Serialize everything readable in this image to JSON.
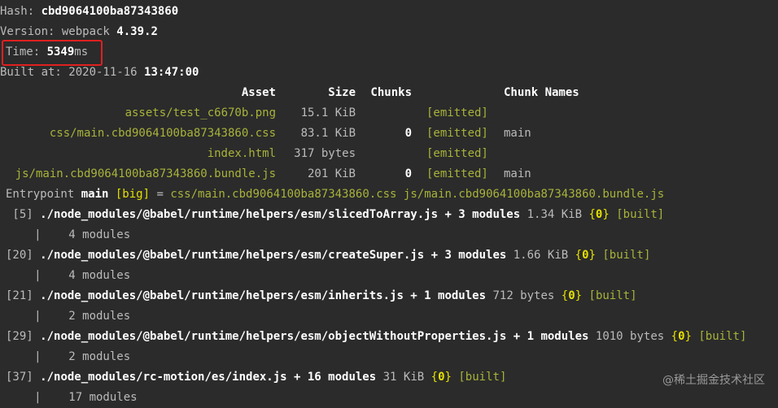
{
  "build": {
    "hash_label": "Hash: ",
    "hash_value": "cbd9064100ba87343860",
    "version_label": "Version: webpack ",
    "version_value": "4.39.2",
    "time_label": "Time: ",
    "time_value": "5349",
    "time_unit": "ms",
    "built_label": "Built at: 2020-11-16 ",
    "built_time": "13:47:00"
  },
  "table": {
    "headers": [
      "Asset",
      "Size",
      "Chunks",
      "Chunk Names"
    ],
    "rows": [
      {
        "asset": "assets/test_c6670b.png",
        "size": "15.1 KiB",
        "chunks": "",
        "emitted": "[emitted]",
        "names": ""
      },
      {
        "asset": "css/main.cbd9064100ba87343860.css",
        "size": "83.1 KiB",
        "chunks": "0",
        "emitted": "[emitted]",
        "names": "main"
      },
      {
        "asset": "index.html",
        "size": "317 bytes",
        "chunks": "",
        "emitted": "[emitted]",
        "names": ""
      },
      {
        "asset": "js/main.cbd9064100ba87343860.bundle.js",
        "size": "201 KiB",
        "chunks": "0",
        "emitted": "[emitted]",
        "names": "main"
      }
    ]
  },
  "entrypoint": {
    "label": "Entrypoint ",
    "name": "main",
    "big": "[big]",
    "eq": " = ",
    "css": "css/main.cbd9064100ba87343860.css",
    "js": "js/main.cbd9064100ba87343860.bundle.js"
  },
  "modules": [
    {
      "id": " [5]",
      "path": "./node_modules/@babel/runtime/helpers/esm/slicedToArray.js + 3 modules",
      "size": "1.34 KiB",
      "chunk": "0",
      "status": "[built]",
      "sub": "     |    4 modules"
    },
    {
      "id": "[20]",
      "path": "./node_modules/@babel/runtime/helpers/esm/createSuper.js + 3 modules",
      "size": "1.66 KiB",
      "chunk": "0",
      "status": "[built]",
      "sub": "     |    4 modules"
    },
    {
      "id": "[21]",
      "path": "./node_modules/@babel/runtime/helpers/esm/inherits.js + 1 modules",
      "size": "712 bytes",
      "chunk": "0",
      "status": "[built]",
      "sub": "     |    2 modules"
    },
    {
      "id": "[29]",
      "path": "./node_modules/@babel/runtime/helpers/esm/objectWithoutProperties.js + 1 modules",
      "size": "1010 bytes",
      "chunk": "0",
      "status": "[built]",
      "sub": "     |    2 modules"
    },
    {
      "id": "[37]",
      "path": "./node_modules/rc-motion/es/index.js + 16 modules",
      "size": "31 KiB",
      "chunk": "0",
      "status": "[built]",
      "sub": "     |    17 modules"
    }
  ],
  "watermark": "@稀土掘金技术社区",
  "colors": {
    "background": "#2b2b2b",
    "highlight_border": "#e02020",
    "emitted": "#a8b33a",
    "chunk_brace": "#e4e000"
  }
}
